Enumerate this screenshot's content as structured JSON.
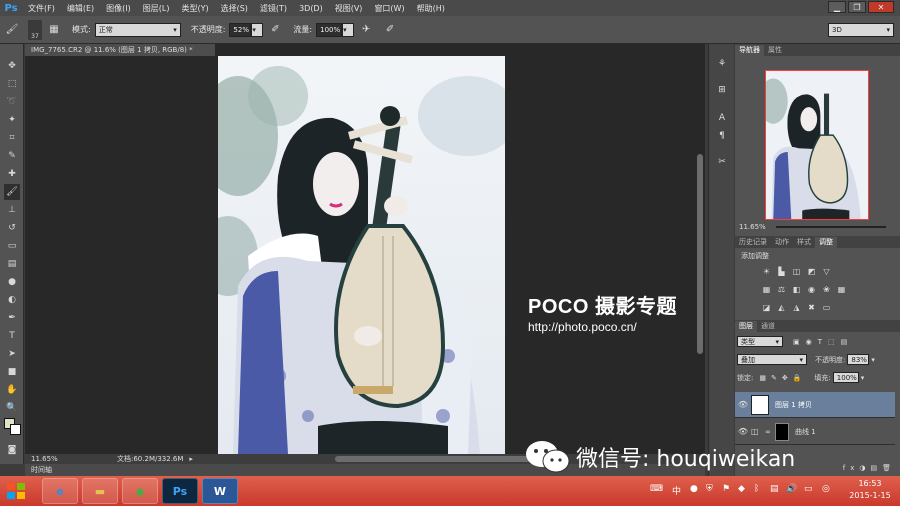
{
  "app": {
    "logo": "Ps"
  },
  "menu": [
    "文件(F)",
    "编辑(E)",
    "图像(I)",
    "图层(L)",
    "类型(Y)",
    "选择(S)",
    "滤镜(T)",
    "3D(D)",
    "视图(V)",
    "窗口(W)",
    "帮助(H)"
  ],
  "options": {
    "brush_size": "37",
    "mode_label": "模式:",
    "mode_value": "正常",
    "opacity_label": "不透明度:",
    "opacity_value": "52%",
    "flow_label": "流量:",
    "flow_value": "100%",
    "workspace": "3D"
  },
  "document": {
    "tab_title": "IMG_7765.CR2 @ 11.6% (图层 1 拷贝, RGB/8) *",
    "zoom": "11.65%",
    "doc_size": "文档:60.2M/332.6M"
  },
  "watermark": {
    "title": "POCO 摄影专题",
    "url": "http://photo.poco.cn/"
  },
  "timeline_label": "时间轴",
  "panels": {
    "nav_tabs": [
      "导航器",
      "属性"
    ],
    "nav_zoom": "11.65%",
    "adj_tabs": [
      "历史记录",
      "动作",
      "样式",
      "调整"
    ],
    "adj_title": "添加调整",
    "layers_tabs": [
      "图层",
      "通道"
    ],
    "filter_kind": "类型",
    "blend_mode": "叠加",
    "opacity_label": "不透明度:",
    "opacity_value": "83%",
    "lock_label": "锁定:",
    "fill_label": "填充:",
    "fill_value": "100%",
    "layers": [
      {
        "name": "图层 1 拷贝",
        "selected": true
      },
      {
        "name": "曲线 1",
        "selected": false
      }
    ]
  },
  "wechat": {
    "text": "微信号: houqiweikan"
  },
  "taskbar": {
    "ps_label": "Ps",
    "word_label": "W",
    "time": "16:53",
    "date": "2015-1-15"
  }
}
